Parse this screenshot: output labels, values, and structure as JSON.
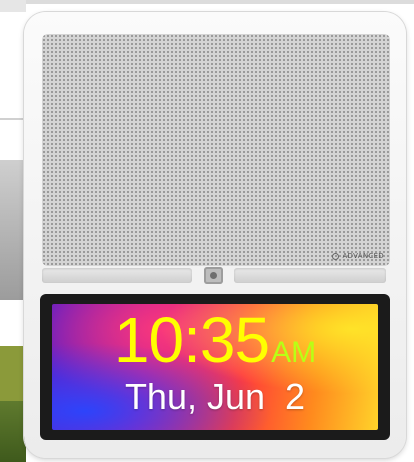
{
  "clock": {
    "time": "10:35",
    "ampm": "AM",
    "date": "Thu, Jun  2"
  },
  "brand": {
    "logo_text": "ADVANCED"
  }
}
